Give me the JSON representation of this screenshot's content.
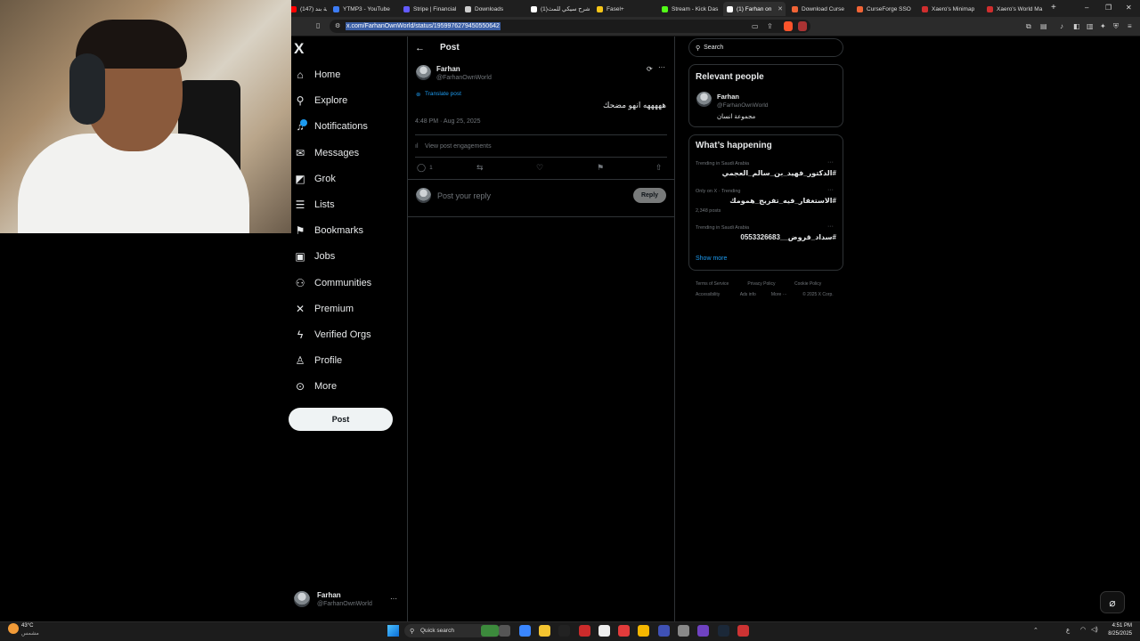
{
  "browser": {
    "tabs": [
      {
        "label": "أغنية بند (147)",
        "favicon_color": "#ff0000"
      },
      {
        "label": "YTMP3 - YouTube",
        "favicon_color": "#3d7cf5"
      },
      {
        "label": "Stripe | Financial",
        "favicon_color": "#635bff"
      },
      {
        "label": "Downloads",
        "favicon_color": "#cccccc"
      },
      {
        "label": "(1)شرح سيكي للمث",
        "favicon_color": "#ffffff"
      },
      {
        "label": "Fasel+",
        "favicon_color": "#f5c518"
      },
      {
        "label": "Stream - Kick Das",
        "favicon_color": "#53fc18"
      },
      {
        "label": "(1) Farhan on",
        "favicon_color": "#ffffff"
      },
      {
        "label": "Download Curse",
        "favicon_color": "#f16436"
      },
      {
        "label": "CurseForge SSO",
        "favicon_color": "#f16436"
      },
      {
        "label": "Xaero's Minimap",
        "favicon_color": "#d02e2e"
      },
      {
        "label": "Xaero's World Ma",
        "favicon_color": "#d02e2e"
      }
    ],
    "active_tab_index": 7,
    "new_tab": "+",
    "url": "x.com/FarhanOwnWorld/status/1959976279450550642",
    "window_controls": {
      "minimize": "–",
      "restore": "❐",
      "close": "✕"
    }
  },
  "sidebar": {
    "logo": "X",
    "items": [
      {
        "label": "Home",
        "icon": "home-icon",
        "glyph": "⌂"
      },
      {
        "label": "Explore",
        "icon": "search-icon",
        "glyph": "⚲"
      },
      {
        "label": "Notifications",
        "icon": "bell-icon",
        "glyph": "♫"
      },
      {
        "label": "Messages",
        "icon": "envelope-icon",
        "glyph": "✉"
      },
      {
        "label": "Grok",
        "icon": "grok-icon",
        "glyph": "◩"
      },
      {
        "label": "Lists",
        "icon": "list-icon",
        "glyph": "☰"
      },
      {
        "label": "Bookmarks",
        "icon": "bookmark-icon",
        "glyph": "⚑"
      },
      {
        "label": "Jobs",
        "icon": "briefcase-icon",
        "glyph": "▣"
      },
      {
        "label": "Communities",
        "icon": "people-icon",
        "glyph": "⚇"
      },
      {
        "label": "Premium",
        "icon": "x-premium-icon",
        "glyph": "✕"
      },
      {
        "label": "Verified Orgs",
        "icon": "lightning-icon",
        "glyph": "ϟ"
      },
      {
        "label": "Profile",
        "icon": "person-icon",
        "glyph": "♙"
      },
      {
        "label": "More",
        "icon": "more-circle-icon",
        "glyph": "⊙"
      }
    ],
    "post_button": "Post",
    "account": {
      "name": "Farhan",
      "handle": "@FarhanOwnWorld",
      "more": "···"
    }
  },
  "post_page": {
    "header": "Post",
    "author": {
      "name": "Farhan",
      "handle": "@FarhanOwnWorld"
    },
    "translate": "Translate post",
    "text": "هههههه انهو مضحك",
    "timestamp": "4:48 PM · Aug 25, 2025",
    "engagements": "View post engagements",
    "reply_count": "1",
    "reply_placeholder": "Post your reply",
    "reply_button": "Reply",
    "more": "···"
  },
  "right": {
    "search_placeholder": "Search",
    "relevant": {
      "title": "Relevant people",
      "name": "Farhan",
      "handle": "@FarhanOwnWorld",
      "bio": "مجموعة انسان"
    },
    "happening": {
      "title": "What’s happening",
      "trends": [
        {
          "meta": "Trending in Saudi Arabia",
          "name": "#الدكتور_فهيد_بن_سالم_العجمي",
          "posts": ""
        },
        {
          "meta": "Only on X · Trending",
          "name": "#الاستغفار_فيه_تفريج_همومك",
          "posts": "2,348 posts"
        },
        {
          "meta": "Trending in Saudi Arabia",
          "name": "#سداد_قروض__0553326683",
          "posts": ""
        }
      ],
      "show_more": "Show more"
    },
    "footer": {
      "line1": [
        "Terms of Service",
        "Privacy Policy",
        "Cookie Policy"
      ],
      "line2": [
        "Accessibility",
        "Ads info",
        "More ···",
        "© 2025 X Corp."
      ]
    }
  },
  "taskbar": {
    "weather_temp": "43°C",
    "weather_desc": "مشمس",
    "search": "Quick search",
    "time": "4:51 PM",
    "date": "8/25/2025",
    "lang": "ع"
  },
  "colors": {
    "accent": "#1d9bf0",
    "border": "#2f3336",
    "muted": "#71767b"
  }
}
